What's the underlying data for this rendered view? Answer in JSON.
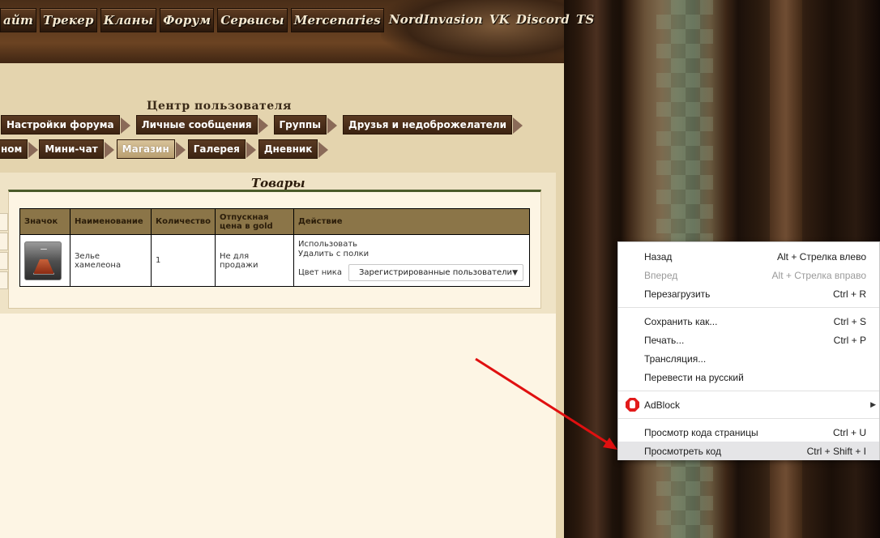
{
  "topnav": {
    "items": [
      "айт",
      "Трекер",
      "Кланы",
      "Форум",
      "Сервисы",
      "Mercenaries",
      "NordInvasion",
      "VK",
      "Discord",
      "TS"
    ]
  },
  "ucp": {
    "title": "Центр пользователя",
    "tabs_row1": [
      "Настройки форума",
      "Личные сообщения",
      "Группы",
      "Друзья и недоброжелатели"
    ],
    "tabs_row2": [
      "ном",
      "Мини-чат",
      "Магазин",
      "Галерея",
      "Дневник"
    ],
    "active_tab": "Магазин"
  },
  "goods": {
    "title": "Товары",
    "columns": [
      "Значок",
      "Наименование",
      "Количество",
      "Отпускная цена в gold",
      "Действие"
    ],
    "rows": [
      {
        "icon": "potion-icon",
        "name": "Зелье хамелеона",
        "quantity": "1",
        "price": "Не для продажи",
        "action_use": "Использовать",
        "action_remove": "Удалить с полки",
        "nick_color_label": "Цвет ника",
        "nick_color_value": "Зарегистрированные пользователи"
      }
    ]
  },
  "context_menu": {
    "items": [
      {
        "label": "Назад",
        "shortcut": "Alt + Стрелка влево",
        "disabled": false
      },
      {
        "label": "Вперед",
        "shortcut": "Alt + Стрелка вправо",
        "disabled": true
      },
      {
        "label": "Перезагрузить",
        "shortcut": "Ctrl + R",
        "disabled": false
      },
      {
        "label": "Сохранить как...",
        "shortcut": "Ctrl + S",
        "disabled": false
      },
      {
        "label": "Печать...",
        "shortcut": "Ctrl + P",
        "disabled": false
      },
      {
        "label": "Трансляция...",
        "shortcut": "",
        "disabled": false
      },
      {
        "label": "Перевести на русский",
        "shortcut": "",
        "disabled": false
      },
      {
        "label": "AdBlock",
        "shortcut": "",
        "disabled": false,
        "submenu": true
      },
      {
        "label": "Просмотр кода страницы",
        "shortcut": "Ctrl + U",
        "disabled": false
      },
      {
        "label": "Просмотреть код",
        "shortcut": "Ctrl + Shift + I",
        "disabled": false,
        "highlighted": true
      }
    ]
  },
  "colors": {
    "accent_arrow": "#e01010",
    "table_header": "#8b7548",
    "panel_bg": "#fdf5e4"
  }
}
